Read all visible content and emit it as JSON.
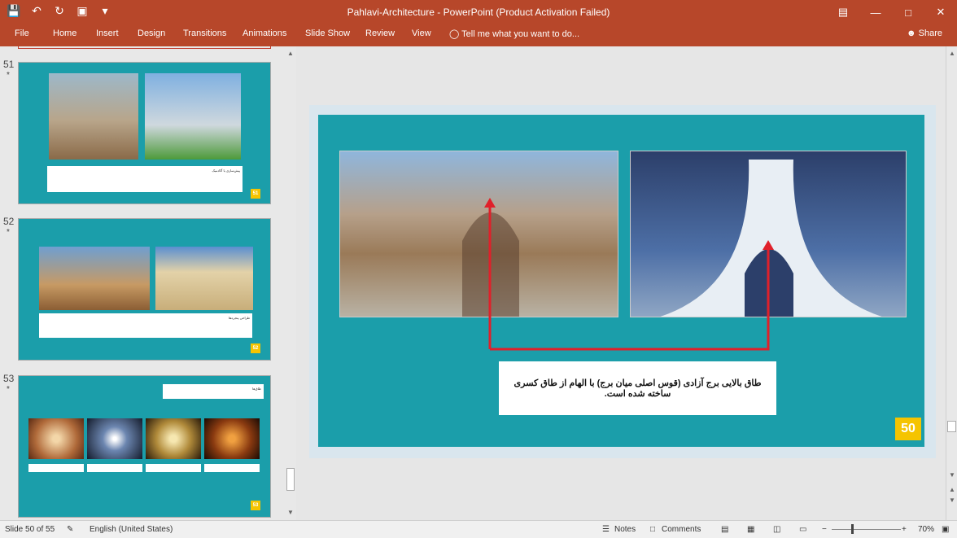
{
  "window": {
    "title": "Pahlavi-Architecture - PowerPoint (Product Activation Failed)"
  },
  "ribbon": {
    "file": "File",
    "tabs": [
      "Home",
      "Insert",
      "Design",
      "Transitions",
      "Animations",
      "Slide Show",
      "Review",
      "View"
    ],
    "tell_me": "Tell me what you want to do...",
    "share": "Share"
  },
  "thumbnails": [
    {
      "number": "51",
      "star": "*",
      "text": "پیش‌سازی یا آکادمیک",
      "badge": "51"
    },
    {
      "number": "52",
      "star": "*",
      "text": "طراحی پنجره‌ها",
      "badge": "52"
    },
    {
      "number": "53",
      "star": "*",
      "text": "طاق‌ها",
      "badge": "53"
    }
  ],
  "current_slide": {
    "caption": "طاق بالایی برج آزادی (قوس اصلی میان برج) با الهام از طاق کسری ساخته شده است.",
    "number": "50"
  },
  "status": {
    "slide_counter": "Slide 50 of 55",
    "language": "English (United States)",
    "notes": "Notes",
    "comments": "Comments",
    "zoom": "70%"
  },
  "colors": {
    "accent": "#b7472a",
    "slide_teal": "#1b9eaa",
    "badge_yellow": "#f5c400",
    "arrow_red": "#e0202a"
  }
}
